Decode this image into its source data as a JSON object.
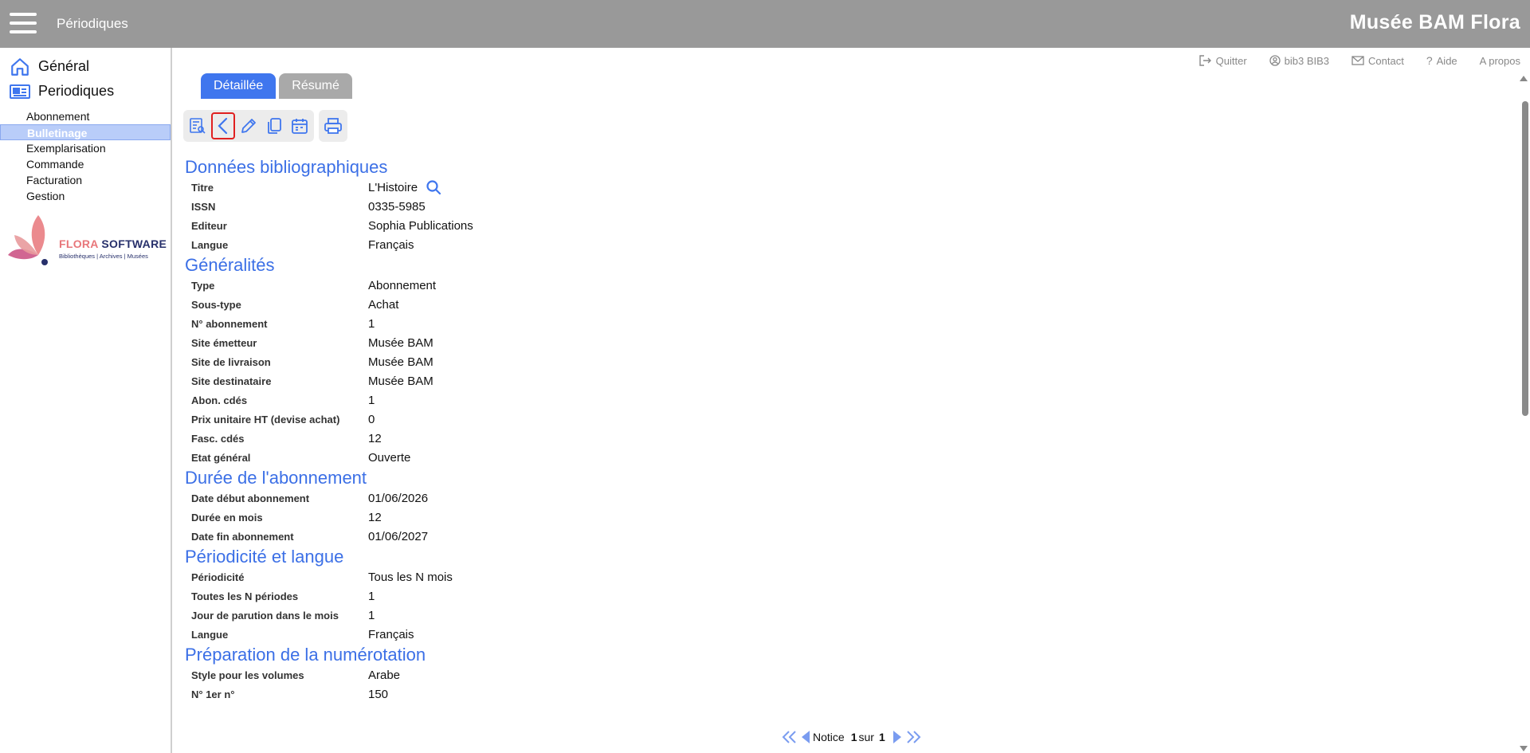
{
  "header": {
    "module_title": "Périodiques",
    "brand": "Musée BAM Flora"
  },
  "sidebar": {
    "main_items": [
      {
        "label": "Général",
        "icon": "home-icon"
      },
      {
        "label": "Periodiques",
        "icon": "newspaper-icon"
      }
    ],
    "sub_items": [
      {
        "label": "Abonnement",
        "active": false
      },
      {
        "label": "Bulletinage",
        "active": true
      },
      {
        "label": "Exemplarisation",
        "active": false
      },
      {
        "label": "Commande",
        "active": false
      },
      {
        "label": "Facturation",
        "active": false
      },
      {
        "label": "Gestion",
        "active": false
      }
    ],
    "logo": {
      "title_part1": "FLORA",
      "title_part2": " SOFTWARE",
      "subtitle": "Bibliothèques | Archives | Musées"
    }
  },
  "toplinks": {
    "quit": "Quitter",
    "user": "bib3 BIB3",
    "contact": "Contact",
    "help": "Aide",
    "about": "A propos"
  },
  "tabs": {
    "detailed": "Détaillée",
    "summary": "Résumé"
  },
  "toolbar": {
    "icons": [
      "list-search-icon",
      "back-chevron-icon",
      "pencil-icon",
      "copy-icon",
      "calendar-icon",
      "printer-icon"
    ]
  },
  "sections": [
    {
      "title": "Données bibliographiques",
      "fields": [
        {
          "label": "Titre",
          "value": "L'Histoire"
        },
        {
          "label": "ISSN",
          "value": "0335-5985"
        },
        {
          "label": "Editeur",
          "value": "Sophia Publications"
        },
        {
          "label": "Langue",
          "value": "Français"
        }
      ]
    },
    {
      "title": "Généralités",
      "fields": [
        {
          "label": "Type",
          "value": "Abonnement"
        },
        {
          "label": "Sous-type",
          "value": "Achat"
        },
        {
          "label": "N° abonnement",
          "value": "1"
        },
        {
          "label": "Site émetteur",
          "value": "Musée BAM"
        },
        {
          "label": "Site de livraison",
          "value": "Musée BAM"
        },
        {
          "label": "Site destinataire",
          "value": "Musée BAM"
        },
        {
          "label": "Abon. cdés",
          "value": "1"
        },
        {
          "label": "Prix unitaire HT (devise achat)",
          "value": "0"
        },
        {
          "label": "Fasc. cdés",
          "value": "12"
        },
        {
          "label": "Etat général",
          "value": "Ouverte"
        }
      ]
    },
    {
      "title": "Durée de l'abonnement",
      "fields": [
        {
          "label": "Date début abonnement",
          "value": "01/06/2026"
        },
        {
          "label": "Durée en mois",
          "value": "12"
        },
        {
          "label": "Date fin abonnement",
          "value": "01/06/2027"
        }
      ]
    },
    {
      "title": "Périodicité et langue",
      "fields": [
        {
          "label": "Périodicité",
          "value": "Tous les N mois"
        },
        {
          "label": "Toutes les N périodes",
          "value": "1"
        },
        {
          "label": "Jour de parution dans le mois",
          "value": "1"
        },
        {
          "label": "Langue",
          "value": "Français"
        }
      ]
    },
    {
      "title": "Préparation de la numérotation",
      "fields": [
        {
          "label": "Style pour les volumes",
          "value": "Arabe"
        },
        {
          "label": "N° 1er n°",
          "value": "150"
        }
      ]
    }
  ],
  "pager": {
    "label": "Notice",
    "current": "1",
    "of": "sur",
    "total": "1"
  },
  "colors": {
    "accent": "#3f76ee",
    "topbar": "#999999",
    "section_title": "#3b6fe6"
  }
}
